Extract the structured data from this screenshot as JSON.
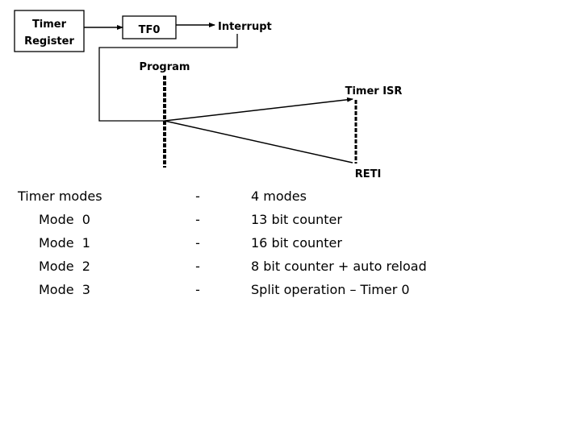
{
  "diagram": {
    "timer_register": "Timer\nRegister",
    "timer_register_line1": "Timer",
    "timer_register_line2": "Register",
    "tf0": "TF0",
    "interrupt": "Interrupt",
    "program": "Program",
    "timer_isr": "Timer ISR",
    "reti": "RETI"
  },
  "modes": {
    "heading": "Timer modes",
    "heading_desc": "4 modes",
    "separator": "-",
    "items": [
      {
        "label": "Mode",
        "number": "0",
        "desc": "13 bit counter"
      },
      {
        "label": "Mode",
        "number": "1",
        "desc": "16 bit counter"
      },
      {
        "label": "Mode",
        "number": "2",
        "desc": "8 bit counter + auto reload"
      },
      {
        "label": "Mode",
        "number": "3",
        "desc": "Split operation – Timer 0"
      }
    ]
  },
  "colors": {
    "stroke": "#000000",
    "background": "#ffffff"
  }
}
